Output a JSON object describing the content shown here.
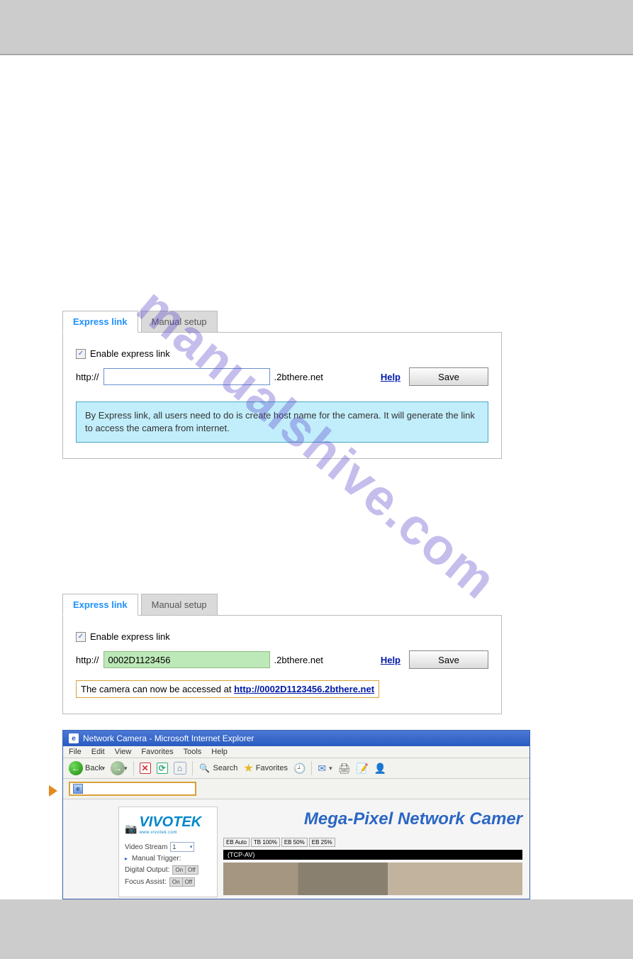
{
  "watermark": "manualshive.com",
  "panel1": {
    "tabs": {
      "active": "Express link",
      "inactive": "Manual setup"
    },
    "enable_label": "Enable express link",
    "protocol": "http://",
    "host_value": "",
    "domain": ".2bthere.net",
    "help": "Help",
    "save": "Save",
    "info": "By Express link, all users need to do is create host name for the camera. It will generate the link to access the camera from internet."
  },
  "panel2": {
    "tabs": {
      "active": "Express link",
      "inactive": "Manual setup"
    },
    "enable_label": "Enable express link",
    "protocol": "http://",
    "host_value": "0002D1123456",
    "domain": ".2bthere.net",
    "help": "Help",
    "save": "Save",
    "status_prefix": "The camera can now be accessed at ",
    "status_link": "http://0002D1123456.2bthere.net"
  },
  "browser": {
    "title": "Network Camera - Microsoft Internet Explorer",
    "menu": [
      "File",
      "Edit",
      "View",
      "Favorites",
      "Tools",
      "Help"
    ],
    "back": "Back",
    "search": "Search",
    "favorites": "Favorites",
    "content_title": "Mega-Pixel Network Camer",
    "logo": "VIVOTEK",
    "logo_sub": "www.vivotek.com",
    "video_stream_label": "Video Stream",
    "video_stream_value": "1",
    "manual_trigger": "Manual Trigger:",
    "digital_output": "Digital Output:",
    "focus_assist": "Focus Assist:",
    "modes": [
      "EB Auto",
      "TB 100%",
      "EB 50%",
      "EB 25%"
    ],
    "video_bar": "(TCP-AV)"
  }
}
